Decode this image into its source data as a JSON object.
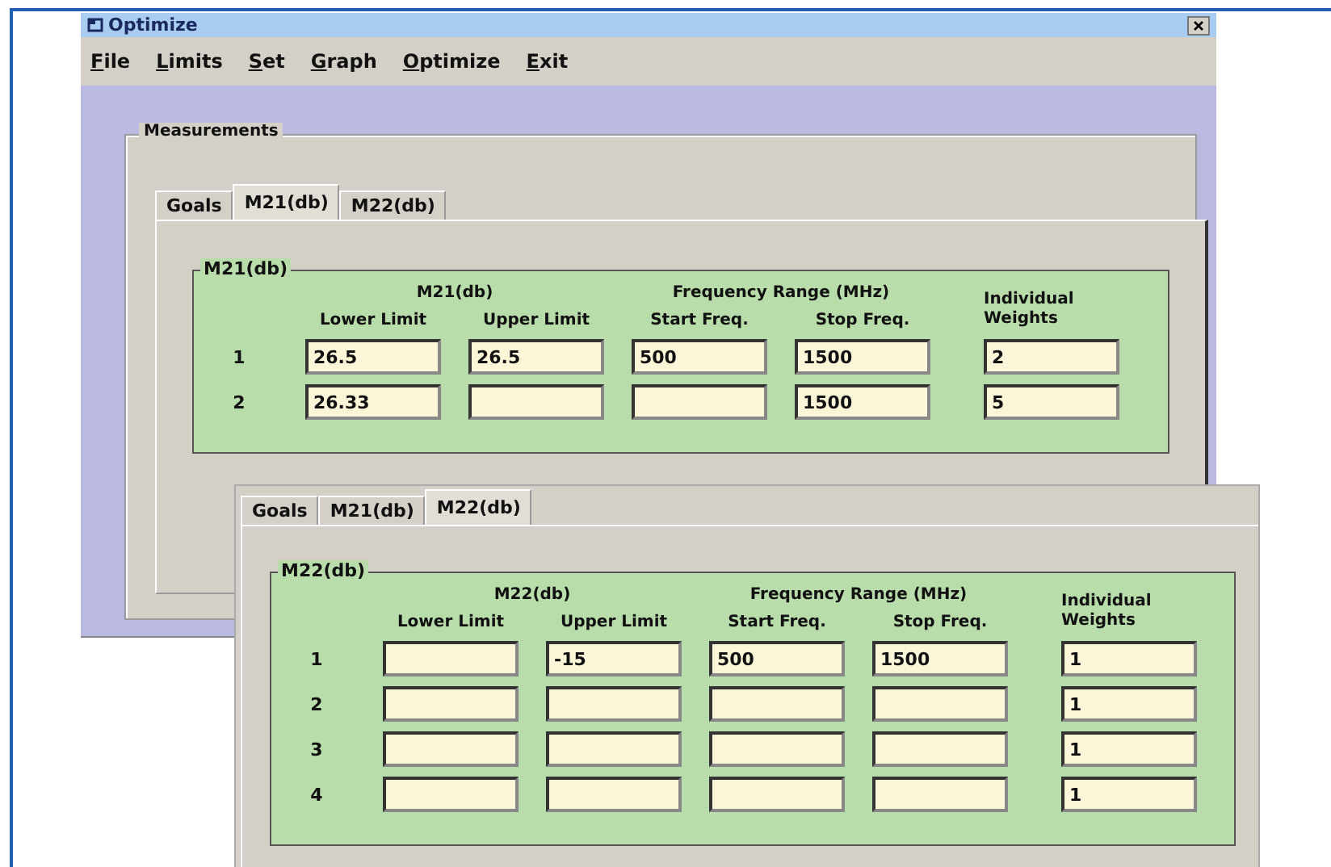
{
  "window": {
    "title": "Optimize"
  },
  "menu": [
    {
      "label": "File"
    },
    {
      "label": "Limits"
    },
    {
      "label": "Set"
    },
    {
      "label": "Graph"
    },
    {
      "label": "Optimize"
    },
    {
      "label": "Exit"
    }
  ],
  "measurements": {
    "title": "Measurements"
  },
  "panels": [
    {
      "tabs": [
        {
          "label": "Goals",
          "selected": false
        },
        {
          "label": "M21(db)",
          "selected": true
        },
        {
          "label": "M22(db)",
          "selected": false
        }
      ],
      "group_title": "M21(db)",
      "limit_heading": "M21(db)",
      "freq_heading": "Frequency Range (MHz)",
      "weights_heading": "Individual Weights",
      "columns": [
        "Lower Limit",
        "Upper Limit",
        "Start Freq.",
        "Stop Freq."
      ],
      "rows": [
        {
          "index": "1",
          "lower_limit": "26.5",
          "upper_limit": "26.5",
          "start_freq": "500",
          "stop_freq": "1500",
          "weight": "2"
        },
        {
          "index": "2",
          "lower_limit": "26.33",
          "stop_freq": "1500",
          "weight": "5"
        }
      ]
    },
    {
      "tabs": [
        {
          "label": "Goals",
          "selected": false
        },
        {
          "label": "M21(db)",
          "selected": false
        },
        {
          "label": "M22(db)",
          "selected": true
        }
      ],
      "group_title": "M22(db)",
      "limit_heading": "M22(db)",
      "freq_heading": "Frequency Range (MHz)",
      "weights_heading": "Individual Weights",
      "columns": [
        "Lower Limit",
        "Upper Limit",
        "Start Freq.",
        "Stop Freq."
      ],
      "rows": [
        {
          "index": "1",
          "upper_limit": "-15",
          "start_freq": "500",
          "stop_freq": "1500",
          "weight": "1"
        },
        {
          "index": "2",
          "weight": "1"
        },
        {
          "index": "3",
          "weight": "1"
        },
        {
          "index": "4",
          "weight": "1"
        }
      ]
    }
  ]
}
